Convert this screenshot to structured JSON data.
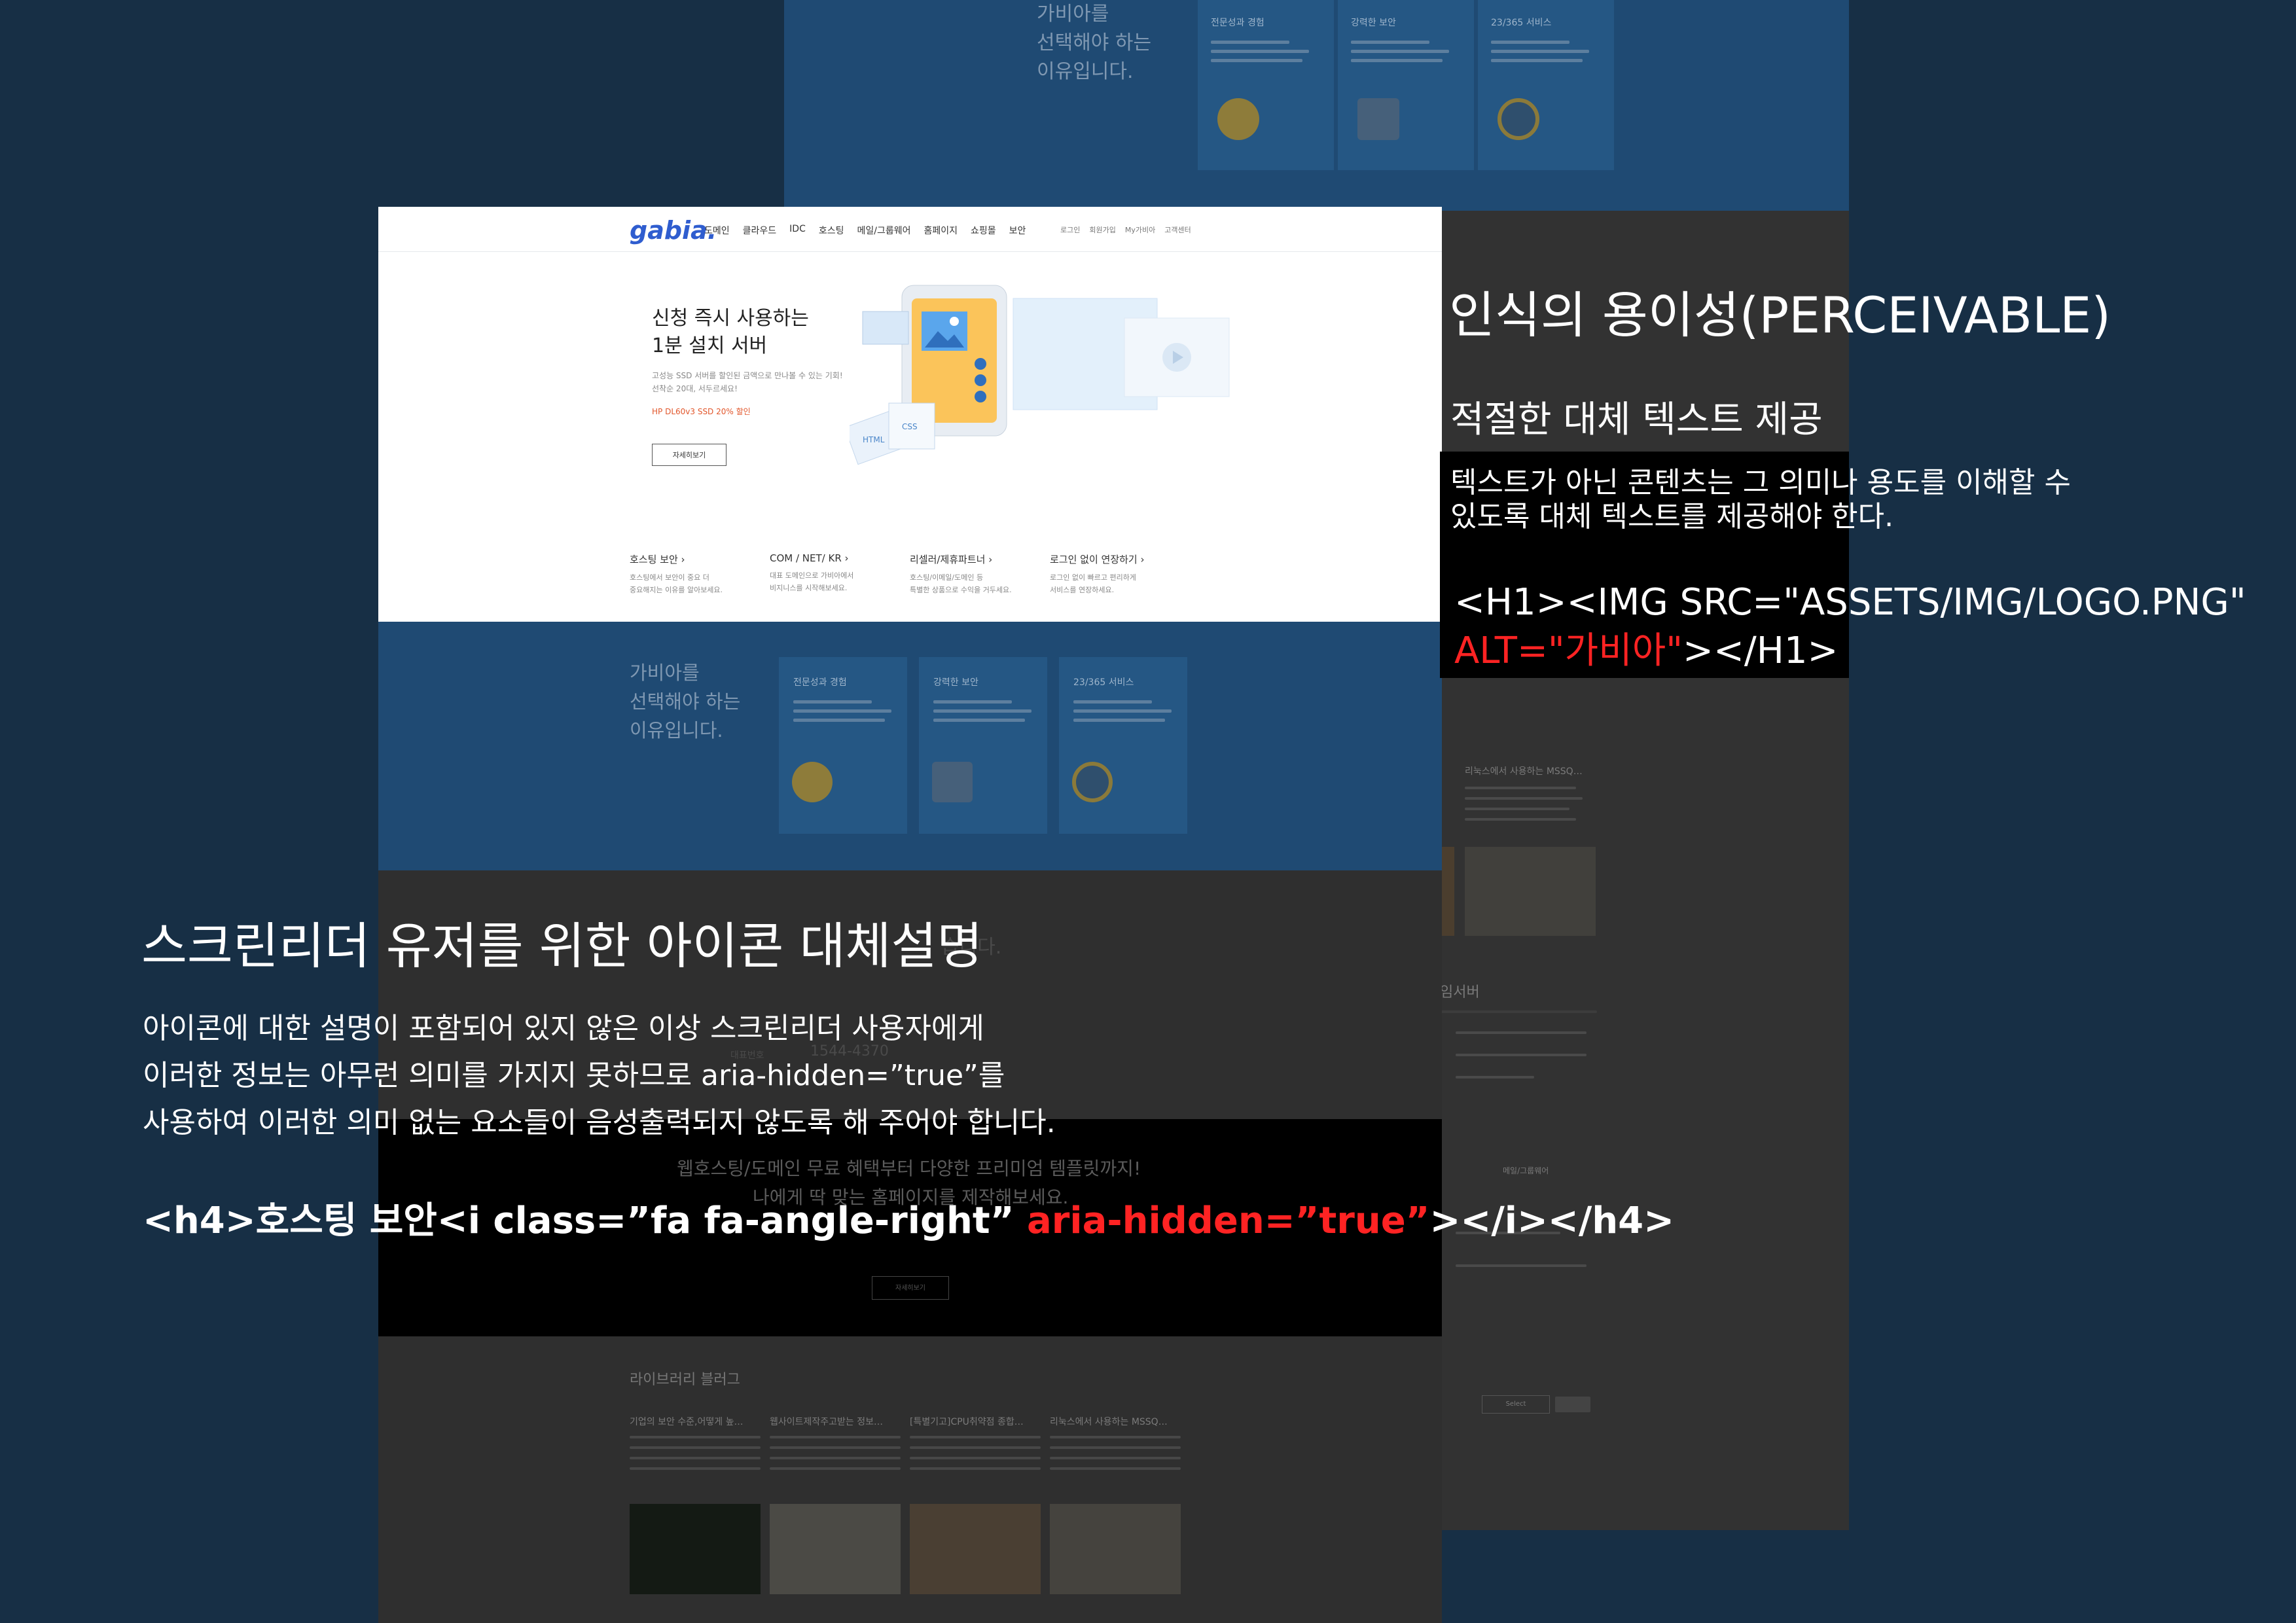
{
  "bg_top": {
    "title": "가비아를\n선택해야 하는\n이유입니다.",
    "cards": [
      "전문성과 경험",
      "강력한 보안",
      "23/365 서비스"
    ]
  },
  "gnb": {
    "logo": "gabia.",
    "menu": [
      "도메인",
      "클라우드",
      "IDC",
      "호스팅",
      "메일/그룹웨어",
      "홈페이지",
      "쇼핑몰",
      "보안"
    ],
    "util": [
      "로그인",
      "회원가입",
      "My가비아",
      "고객센터"
    ]
  },
  "hero": {
    "title": "신청 즉시 사용하는\n1분 설치 서버",
    "desc": "고성능 SSD 서버를 할인된 금액으로 만나볼 수 있는 기회!\n선착순 20대, 서두르세요!",
    "promo": "HP DL60v3 SSD 20% 할인",
    "button": "자세히보기"
  },
  "features": [
    {
      "title": "호스팅 보안 ›",
      "desc": "호스팅에서 보안이 중요 더\n중요해지는 이유를 알아보세요."
    },
    {
      "title": "COM / NET/ KR ›",
      "desc": "대표 도메인으로 가비아에서\n비지니스를 시작해보세요."
    },
    {
      "title": "리셀러/제휴파트너 ›",
      "desc": "호스팅/이메일/도메인 등\n특별한 상품으로 수익을 거두세요."
    },
    {
      "title": "로그인 없이 연장하기 ›",
      "desc": "로그인 없이 빠르고 편리하게\n서비스를 연장하세요."
    }
  ],
  "why": {
    "title": "가비아를\n선택해야 하는\n이유입니다.",
    "cards": [
      "전문성과 경험",
      "강력한 보안",
      "23/365 서비스"
    ]
  },
  "grey_section": {
    "tail_text": "습니다.",
    "phone_label": "대표번호",
    "phone": "1544-4370"
  },
  "black_section": {
    "line1": "웹호스팅/도메인 무료 혜택부터 다양한 프리미엄 템플릿까지!",
    "line2": "나에게 딱 맞는 홈페이지를 제작해보세요.",
    "button": "자세히보기"
  },
  "library": {
    "title": "라이브러리 블러그",
    "posts": [
      "기업의 보안 수준,어떻게 높…",
      "웹사이트제작주고받는 정보…",
      "[특별기고]CPU취약점 종합…",
      "리눅스에서 사용하는 MSSQ…"
    ]
  },
  "right_page": {
    "post": "리눅스에서 사용하는 MSSQ…",
    "server_label": "임서버",
    "mail_label": "메일/그룹웨어",
    "select_label": "Select"
  },
  "perceivable": {
    "heading": "인식의 용이성(PERCEIVABLE)",
    "subheading": "적절한 대체 텍스트 제공",
    "description": "텍스트가 아닌 콘텐츠는 그 의미나 용도를 이해할 수\n있도록 대체 텍스트를 제공해야 한다.",
    "code_line1": "<H1><IMG SRC=\"ASSETS/IMG/LOGO.PNG\"",
    "code_alt": "ALT=\"가비아\"",
    "code_end": "></H1>"
  },
  "screen_reader": {
    "heading": "스크린리더 유저를 위한 아이콘 대체설명",
    "description": "아이콘에 대한 설명이 포함되어 있지 않은 이상 스크린리더 사용자에게\n이러한 정보는 아무런 의미를 가지지 못하므로 aria-hidden=”true”를\n사용하여 이러한 의미 없는 요소들이 음성출력되지 않도록 해 주어야 합니다.",
    "code_start": "<h4>호스팅 보안<i class=”fa fa-angle-right” ",
    "code_aria": "aria-hidden=”true”",
    "code_end": "></i></h4>"
  }
}
